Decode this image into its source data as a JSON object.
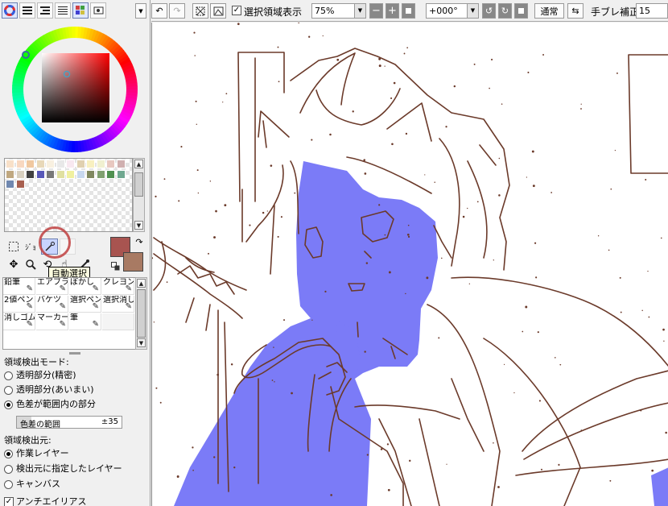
{
  "toolbar": {
    "select_area_label": "選択領域表示",
    "select_area_checked": true,
    "zoom_value": "75%",
    "angle_value": "+000°",
    "blend_mode": "通常",
    "stabilizer_label": "手ブレ補正",
    "stabilizer_value": "15"
  },
  "tools": {
    "tooltip": "自動選択",
    "partial_label": "ｼﾞｮ"
  },
  "brushes": [
    {
      "label": "鉛筆",
      "icon": "pencil-icon"
    },
    {
      "label": "エアブラシ",
      "icon": "airbrush-icon"
    },
    {
      "label": "ぼかし",
      "icon": "blur-icon"
    },
    {
      "label": "クレヨン",
      "icon": "crayon-icon"
    },
    {
      "label": "2値ペン",
      "icon": "binary-pen-icon"
    },
    {
      "label": "バケツ",
      "icon": "bucket-icon"
    },
    {
      "label": "選択ペン",
      "icon": "selection-pen-icon"
    },
    {
      "label": "選択消し",
      "icon": "selection-eraser-icon"
    },
    {
      "label": "消しゴム",
      "icon": "eraser-icon"
    },
    {
      "label": "マーカー",
      "icon": "marker-icon"
    },
    {
      "label": "筆",
      "icon": "brush-icon"
    },
    {
      "label": "",
      "icon": "empty-slot"
    }
  ],
  "detect_mode": {
    "title": "領域検出モード:",
    "options": [
      "透明部分(精密)",
      "透明部分(あいまい)",
      "色差が範囲内の部分"
    ],
    "selected": 2,
    "tolerance_label": "色差の範囲",
    "tolerance_value": "±35",
    "tolerance_fraction": 0.14
  },
  "detect_source": {
    "title": "領域検出元:",
    "options": [
      "作業レイヤー",
      "検出元に指定したレイヤー",
      "キャンバス"
    ],
    "selected": 0
  },
  "antialias": {
    "label": "アンチエイリアス",
    "checked": true
  },
  "colors": {
    "foreground": "#a85450",
    "background": "#a87a63",
    "selection_fill": "#7b7bf7",
    "line_art": "#6b3a2a",
    "swatches": [
      "#f8e0c8",
      "#f8d8c0",
      "#f0c8a0",
      "#e8d8b8",
      "#f8f0e0",
      "#e8e8e8",
      "#f8e8f0",
      "#e0d0b0",
      "#f8f0c0",
      "#f0f0d0",
      "#e8c8c0",
      "#d0b0b0",
      "#c0a880",
      "#d8d0c0",
      "#404040",
      "#5858b8",
      "#787878",
      "#e0e0a0",
      "#f0f0a0",
      "#c8d8f0",
      "#808860",
      "#80a070",
      "#509050",
      "#70a890",
      "#7088b0",
      "#a86050"
    ]
  }
}
